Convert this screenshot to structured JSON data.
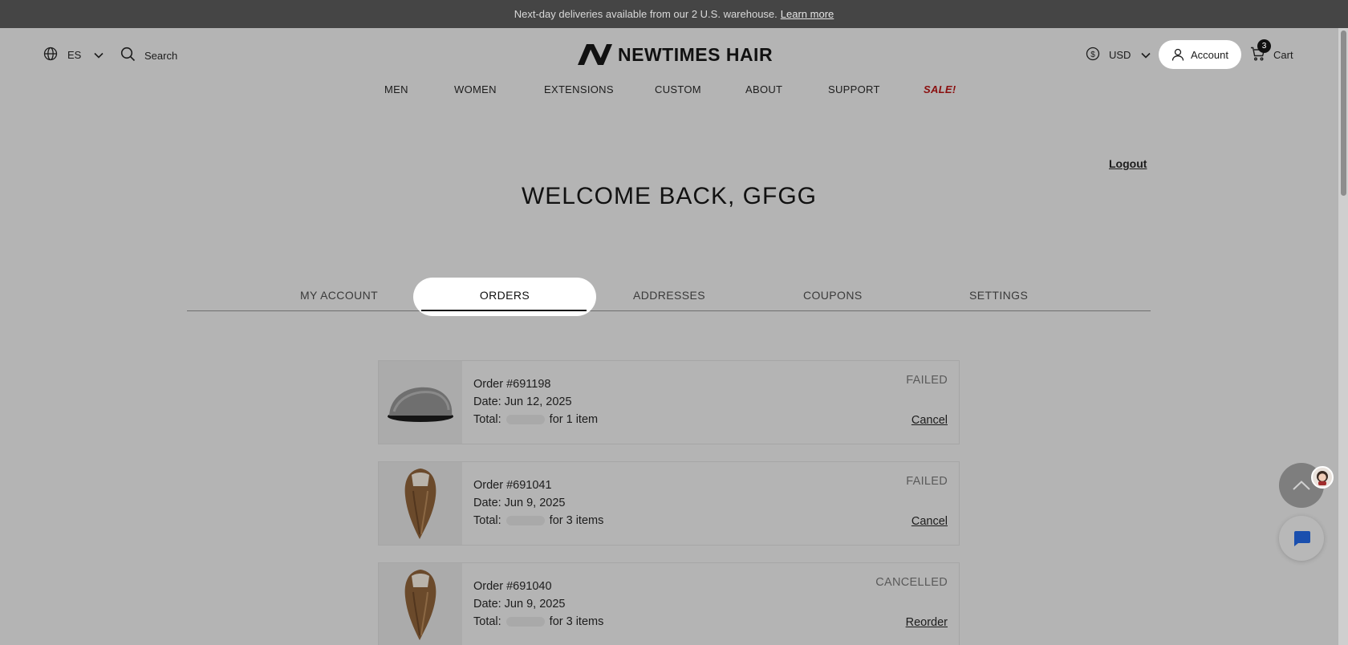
{
  "announcement": {
    "text": "Next-day deliveries available from our 2 U.S. warehouse.",
    "link": "Learn more"
  },
  "header": {
    "language": "ES",
    "search_label": "Search",
    "brand": "NEWTIMES HAIR",
    "currency": "USD",
    "account_label": "Account",
    "cart_label": "Cart",
    "cart_count": "3"
  },
  "nav": {
    "items": [
      "MEN",
      "WOMEN",
      "EXTENSIONS",
      "CUSTOM",
      "ABOUT",
      "SUPPORT",
      "SALE!"
    ]
  },
  "account": {
    "logout_label": "Logout",
    "welcome": "WELCOME BACK, GFGG",
    "tabs": [
      "MY ACCOUNT",
      "ORDERS",
      "ADDRESSES",
      "COUPONS",
      "SETTINGS"
    ],
    "active_tab": "ORDERS"
  },
  "orders": [
    {
      "number": "Order #691198",
      "date": "Date: Jun 12, 2025",
      "total_label": "Total:",
      "items": "for 1 item",
      "status": "FAILED",
      "action": "Cancel",
      "image_icon": "hair-system-icon"
    },
    {
      "number": "Order #691041",
      "date": "Date: Jun 9, 2025",
      "total_label": "Total:",
      "items": "for 3 items",
      "status": "FAILED",
      "action": "Cancel",
      "image_icon": "hair-topper-icon"
    },
    {
      "number": "Order #691040",
      "date": "Date: Jun 9, 2025",
      "total_label": "Total:",
      "items": "for 3 items",
      "status": "CANCELLED",
      "action": "Reorder",
      "image_icon": "hair-topper-icon"
    }
  ],
  "colors": {
    "overlay_background": "#b4b4b4",
    "announcement_bar": "#454545",
    "sale": "#8a0f0f",
    "highlight": "#ffffff",
    "chat_icon": "#1a4fae"
  }
}
